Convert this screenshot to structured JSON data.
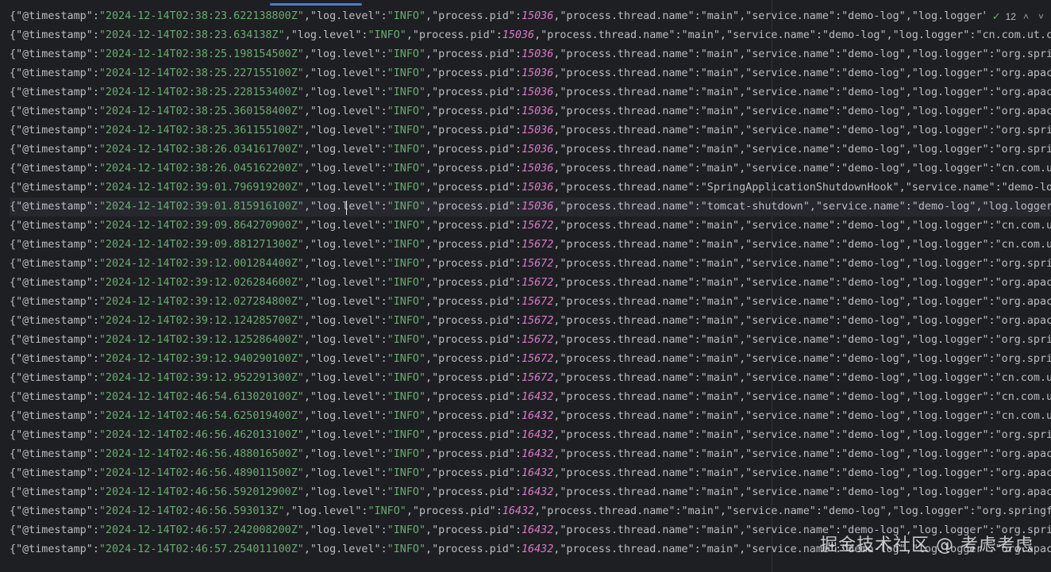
{
  "editor": {
    "lines": [
      {
        "ts": "2024-12-14T02:38:23.622138800Z",
        "pid": "15036",
        "rest": "\"process.thread.name\":\"main\",\"service.name\":\"demo-log\",\"log.logger\"",
        "wide": false
      },
      {
        "ts": "2024-12-14T02:38:23.634138Z",
        "pid": "15036",
        "rest": "\"process.thread.name\":\"main\",\"service.name\":\"demo-log\",\"log.logger\":\"cn.com.ut.cl",
        "wide": false
      },
      {
        "ts": "2024-12-14T02:38:25.198154500Z",
        "pid": "15036",
        "rest": "\"process.thread.name\":\"main\",\"service.name\":\"demo-log\",\"log.logger\":\"org.sprin",
        "wide": false
      },
      {
        "ts": "2024-12-14T02:38:25.227155100Z",
        "pid": "15036",
        "rest": "\"process.thread.name\":\"main\",\"service.name\":\"demo-log\",\"log.logger\":\"org.apach",
        "wide": false
      },
      {
        "ts": "2024-12-14T02:38:25.228153400Z",
        "pid": "15036",
        "rest": "\"process.thread.name\":\"main\",\"service.name\":\"demo-log\",\"log.logger\":\"org.apach",
        "wide": false
      },
      {
        "ts": "2024-12-14T02:38:25.360158400Z",
        "pid": "15036",
        "rest": "\"process.thread.name\":\"main\",\"service.name\":\"demo-log\",\"log.logger\":\"org.apach",
        "wide": false
      },
      {
        "ts": "2024-12-14T02:38:25.361155100Z",
        "pid": "15036",
        "rest": "\"process.thread.name\":\"main\",\"service.name\":\"demo-log\",\"log.logger\":\"org.sprin",
        "wide": false
      },
      {
        "ts": "2024-12-14T02:38:26.034161700Z",
        "pid": "15036",
        "rest": "\"process.thread.name\":\"main\",\"service.name\":\"demo-log\",\"log.logger\":\"org.sprin",
        "wide": false
      },
      {
        "ts": "2024-12-14T02:38:26.045162200Z",
        "pid": "15036",
        "rest": "\"process.thread.name\":\"main\",\"service.name\":\"demo-log\",\"log.logger\":\"cn.com.ut",
        "wide": false
      },
      {
        "ts": "2024-12-14T02:39:01.796919200Z",
        "pid": "15036",
        "rest": "\"process.thread.name\":\"SpringApplicationShutdownHook\",\"service.name\":\"demo-log",
        "wide": false
      },
      {
        "ts": "2024-12-14T02:39:01.815916100Z",
        "pid": "15036",
        "rest": "\"process.thread.name\":\"tomcat-shutdown\",\"service.name\":\"demo-log\",\"log.logger\"",
        "wide": false,
        "current": true
      },
      {
        "ts": "2024-12-14T02:39:09.864270900Z",
        "pid": "15672",
        "rest": "\"process.thread.name\":\"main\",\"service.name\":\"demo-log\",\"log.logger\":\"cn.com.ut",
        "wide": false
      },
      {
        "ts": "2024-12-14T02:39:09.881271300Z",
        "pid": "15672",
        "rest": "\"process.thread.name\":\"main\",\"service.name\":\"demo-log\",\"log.logger\":\"cn.com.ut",
        "wide": false
      },
      {
        "ts": "2024-12-14T02:39:12.001284400Z",
        "pid": "15672",
        "rest": "\"process.thread.name\":\"main\",\"service.name\":\"demo-log\",\"log.logger\":\"org.sprin",
        "wide": false
      },
      {
        "ts": "2024-12-14T02:39:12.026284600Z",
        "pid": "15672",
        "rest": "\"process.thread.name\":\"main\",\"service.name\":\"demo-log\",\"log.logger\":\"org.apach",
        "wide": false
      },
      {
        "ts": "2024-12-14T02:39:12.027284800Z",
        "pid": "15672",
        "rest": "\"process.thread.name\":\"main\",\"service.name\":\"demo-log\",\"log.logger\":\"org.apach",
        "wide": false
      },
      {
        "ts": "2024-12-14T02:39:12.124285700Z",
        "pid": "15672",
        "rest": "\"process.thread.name\":\"main\",\"service.name\":\"demo-log\",\"log.logger\":\"org.apach",
        "wide": false
      },
      {
        "ts": "2024-12-14T02:39:12.125286400Z",
        "pid": "15672",
        "rest": "\"process.thread.name\":\"main\",\"service.name\":\"demo-log\",\"log.logger\":\"org.sprin",
        "wide": false
      },
      {
        "ts": "2024-12-14T02:39:12.940290100Z",
        "pid": "15672",
        "rest": "\"process.thread.name\":\"main\",\"service.name\":\"demo-log\",\"log.logger\":\"org.sprin",
        "wide": false
      },
      {
        "ts": "2024-12-14T02:39:12.952291300Z",
        "pid": "15672",
        "rest": "\"process.thread.name\":\"main\",\"service.name\":\"demo-log\",\"log.logger\":\"cn.com.ut",
        "wide": false
      },
      {
        "ts": "2024-12-14T02:46:54.613020100Z",
        "pid": "16432",
        "rest": "\"process.thread.name\":\"main\",\"service.name\":\"demo-log\",\"log.logger\":\"cn.com.ut",
        "wide": false
      },
      {
        "ts": "2024-12-14T02:46:54.625019400Z",
        "pid": "16432",
        "rest": "\"process.thread.name\":\"main\",\"service.name\":\"demo-log\",\"log.logger\":\"cn.com.ut",
        "wide": false
      },
      {
        "ts": "2024-12-14T02:46:56.462013100Z",
        "pid": "16432",
        "rest": "\"process.thread.name\":\"main\",\"service.name\":\"demo-log\",\"log.logger\":\"org.sprin",
        "wide": false
      },
      {
        "ts": "2024-12-14T02:46:56.488016500Z",
        "pid": "16432",
        "rest": "\"process.thread.name\":\"main\",\"service.name\":\"demo-log\",\"log.logger\":\"org.apach",
        "wide": false
      },
      {
        "ts": "2024-12-14T02:46:56.489011500Z",
        "pid": "16432",
        "rest": "\"process.thread.name\":\"main\",\"service.name\":\"demo-log\",\"log.logger\":\"org.apach",
        "wide": false
      },
      {
        "ts": "2024-12-14T02:46:56.592012900Z",
        "pid": "16432",
        "rest": "\"process.thread.name\":\"main\",\"service.name\":\"demo-log\",\"log.logger\":\"org.apach",
        "wide": false
      },
      {
        "ts": "2024-12-14T02:46:56.593013Z",
        "pid": "16432",
        "rest": "\"process.thread.name\":\"main\",\"service.name\":\"demo-log\",\"log.logger\":\"org.springfr",
        "wide": false
      },
      {
        "ts": "2024-12-14T02:46:57.242008200Z",
        "pid": "16432",
        "rest": "\"process.thread.name\":\"main\",\"service.name\":\"demo-log\",\"log.logger\":\"org.sprin",
        "wide": false
      },
      {
        "ts": "2024-12-14T02:46:57.254011100Z",
        "pid": "16432",
        "rest": "\"process.thread.name\":\"main\",\"service.name\":\"demo-log\",\"log.logger\":\"org.apach",
        "wide": false
      }
    ],
    "prefix_open": "{",
    "key_timestamp": "\"@timestamp\"",
    "key_level": "\"log.level\"",
    "level_value": "\"INFO\"",
    "key_pid": "\"process.pid\""
  },
  "inspection": {
    "check_icon": "check-icon",
    "count": "12",
    "up_arrow": "˄",
    "down_arrow": "˅"
  },
  "watermark": "掘金技术社区 @ 考虑考虑",
  "colors": {
    "background": "#1e1f22",
    "text": "#bcbec4",
    "number": "#d97ac6",
    "accent": "#4a7bd4",
    "check": "#5fb865"
  }
}
